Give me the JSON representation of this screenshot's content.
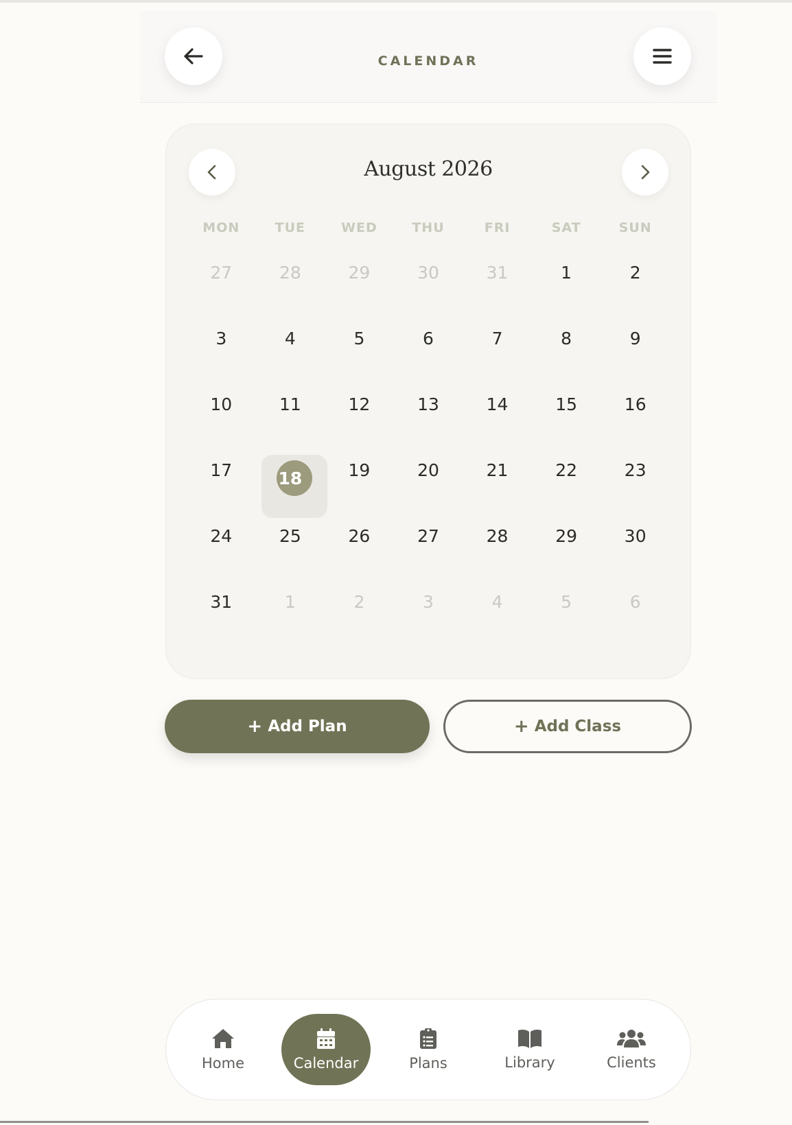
{
  "header": {
    "title": "CALENDAR",
    "back_icon": "arrow-left-icon",
    "menu_icon": "hamburger-menu-icon"
  },
  "calendar": {
    "month_label": "August 2026",
    "weekdays": [
      "MON",
      "TUE",
      "WED",
      "THU",
      "FRI",
      "SAT",
      "SUN"
    ],
    "days": [
      {
        "label": "27",
        "muted": true
      },
      {
        "label": "28",
        "muted": true
      },
      {
        "label": "29",
        "muted": true
      },
      {
        "label": "30",
        "muted": true
      },
      {
        "label": "31",
        "muted": true
      },
      {
        "label": "1"
      },
      {
        "label": "2"
      },
      {
        "label": "3"
      },
      {
        "label": "4"
      },
      {
        "label": "5"
      },
      {
        "label": "6"
      },
      {
        "label": "7"
      },
      {
        "label": "8"
      },
      {
        "label": "9"
      },
      {
        "label": "10"
      },
      {
        "label": "11"
      },
      {
        "label": "12"
      },
      {
        "label": "13"
      },
      {
        "label": "14"
      },
      {
        "label": "15"
      },
      {
        "label": "16"
      },
      {
        "label": "17"
      },
      {
        "label": "18",
        "today": true
      },
      {
        "label": "19"
      },
      {
        "label": "20"
      },
      {
        "label": "21"
      },
      {
        "label": "22"
      },
      {
        "label": "23"
      },
      {
        "label": "24"
      },
      {
        "label": "25"
      },
      {
        "label": "26"
      },
      {
        "label": "27"
      },
      {
        "label": "28"
      },
      {
        "label": "29"
      },
      {
        "label": "30"
      },
      {
        "label": "31"
      },
      {
        "label": "1",
        "muted": true
      },
      {
        "label": "2",
        "muted": true
      },
      {
        "label": "3",
        "muted": true
      },
      {
        "label": "4",
        "muted": true
      },
      {
        "label": "5",
        "muted": true
      },
      {
        "label": "6",
        "muted": true
      }
    ]
  },
  "actions": {
    "add_plan_label": "Add Plan",
    "add_class_label": "Add Class",
    "plus_glyph": "+"
  },
  "tabs": [
    {
      "label": "Home",
      "icon": "home-icon",
      "active": false
    },
    {
      "label": "Calendar",
      "icon": "calendar-icon",
      "active": true
    },
    {
      "label": "Plans",
      "icon": "clipboard-list-icon",
      "active": false
    },
    {
      "label": "Library",
      "icon": "open-book-icon",
      "active": false
    },
    {
      "label": "Clients",
      "icon": "users-group-icon",
      "active": false
    }
  ],
  "colors": {
    "accent": "#717356",
    "today_dot": "#9c9b7d",
    "background": "#fcfbf7",
    "card": "#f6f5f1"
  }
}
